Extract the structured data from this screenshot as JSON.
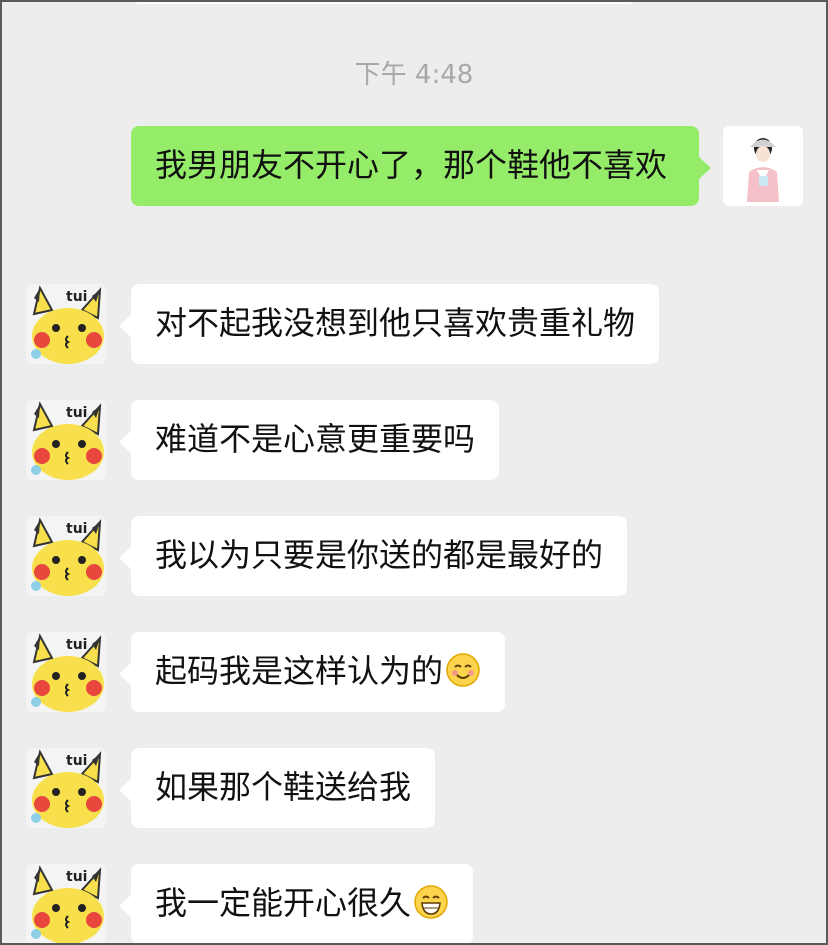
{
  "chat": {
    "timestamp": "下午 4:48",
    "messages": [
      {
        "sender": "self",
        "text": "我男朋友不开心了，那个鞋他不喜欢"
      },
      {
        "sender": "other",
        "text": "对不起我没想到他只喜欢贵重礼物"
      },
      {
        "sender": "other",
        "text": "难道不是心意更重要吗"
      },
      {
        "sender": "other",
        "text": "我以为只要是你送的都是最好的"
      },
      {
        "sender": "other",
        "text": "起码我是这样认为的",
        "emoji": "smiling-blush-emoji"
      },
      {
        "sender": "other",
        "text": "如果那个鞋送给我"
      },
      {
        "sender": "other",
        "text": "我一定能开心很久",
        "emoji": "grinning-emoji"
      }
    ],
    "other_avatar_sticker_text": "tui"
  },
  "colors": {
    "background": "#ededed",
    "self_bubble": "#95ec69",
    "other_bubble": "#ffffff",
    "timestamp_text": "#a8a8a8"
  }
}
